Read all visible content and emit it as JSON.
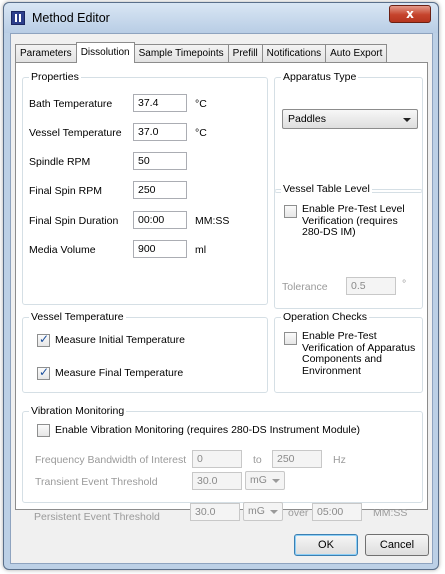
{
  "window": {
    "title": "Method Editor",
    "close_symbol": "x"
  },
  "tabs": [
    {
      "label": "Parameters",
      "active": false
    },
    {
      "label": "Dissolution",
      "active": true
    },
    {
      "label": "Sample Timepoints",
      "active": false
    },
    {
      "label": "Prefill",
      "active": false
    },
    {
      "label": "Notifications",
      "active": false
    },
    {
      "label": "Auto Export",
      "active": false
    }
  ],
  "properties": {
    "title": "Properties",
    "rows": [
      {
        "label": "Bath Temperature",
        "value": "37.4",
        "unit": "°C"
      },
      {
        "label": "Vessel Temperature",
        "value": "37.0",
        "unit": "°C"
      },
      {
        "label": "Spindle RPM",
        "value": "50",
        "unit": ""
      },
      {
        "label": "Final Spin RPM",
        "value": "250",
        "unit": ""
      },
      {
        "label": "Final Spin Duration",
        "value": "00:00",
        "unit": "MM:SS"
      },
      {
        "label": "Media Volume",
        "value": "900",
        "unit": "ml"
      }
    ]
  },
  "apparatus": {
    "title": "Apparatus Type",
    "selected": "Paddles"
  },
  "vessel_table_level": {
    "title": "Vessel Table Level",
    "checkbox_label": "Enable Pre-Test Level Verification (requires 280-DS IM)",
    "checked": false,
    "tolerance_label": "Tolerance",
    "tolerance_value": "0.5",
    "tolerance_unit": "°"
  },
  "vessel_temperature": {
    "title": "Vessel Temperature",
    "measure_initial": {
      "label": "Measure Initial Temperature",
      "checked": true
    },
    "measure_final": {
      "label": "Measure Final Temperature",
      "checked": true
    }
  },
  "operation_checks": {
    "title": "Operation Checks",
    "checkbox_label": "Enable Pre-Test Verification of Apparatus Components and Environment",
    "checked": false
  },
  "vibration": {
    "title": "Vibration Monitoring",
    "enable_label": "Enable Vibration Monitoring (requires 280-DS Instrument Module)",
    "checked": false,
    "freq_label": "Frequency Bandwidth of Interest",
    "freq_from": "0",
    "freq_to_label": "to",
    "freq_to": "250",
    "freq_unit": "Hz",
    "transient_label": "Transient Event Threshold",
    "transient_value": "30.0",
    "transient_unit": "mG",
    "persistent_label": "Persistent Event Threshold",
    "persistent_value": "30.0",
    "persistent_unit": "mG",
    "over_label": "over",
    "persistent_duration": "05:00",
    "duration_unit": "MM:SS"
  },
  "buttons": {
    "ok": "OK",
    "cancel": "Cancel"
  }
}
